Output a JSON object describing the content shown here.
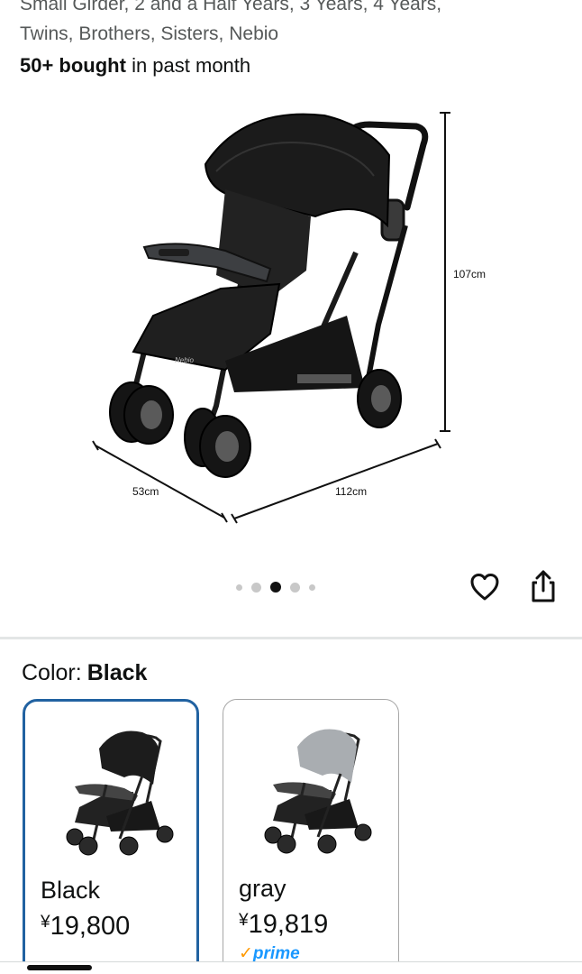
{
  "product": {
    "title_line1": "Small Girder, 2 and a Half Years, 3 Years, 4 Years,",
    "title_line2": "Twins, Brothers, Sisters, Nebio",
    "bought_bold": "50+ bought",
    "bought_rest": " in past month"
  },
  "image": {
    "brand_badge": "Nebio",
    "dim_height": "107cm",
    "dim_width": "53cm",
    "dim_length": "112cm",
    "carousel_total": 5,
    "carousel_active": 3
  },
  "actions": {
    "wishlist_icon": "heart-icon",
    "share_icon": "share-icon"
  },
  "variation": {
    "label": "Color:",
    "selected_value": "Black",
    "options": [
      {
        "name": "Black",
        "price": "19,800",
        "currency": "¥",
        "frame_color": "#2b2b2b",
        "selected": true
      },
      {
        "name": "gray",
        "price": "19,819",
        "currency": "¥",
        "frame_color": "#9ea2a6",
        "prime_text": "prime",
        "selected": false
      }
    ]
  },
  "colors": {
    "selected_border": "#2162a1",
    "prime_blue": "#1a98ff",
    "prime_check": "#ff9900"
  }
}
